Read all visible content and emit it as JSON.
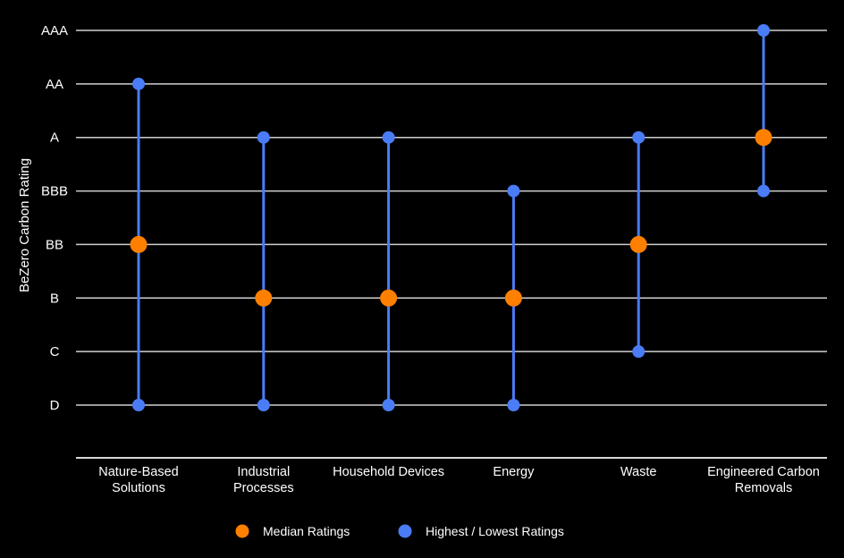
{
  "chart_data": {
    "type": "range-dot",
    "title": "",
    "ylabel": "BeZero Carbon Rating",
    "xlabel": "",
    "y_levels": [
      "D",
      "C",
      "B",
      "BB",
      "BBB",
      "A",
      "AA",
      "AAA"
    ],
    "categories": [
      [
        "Nature-Based",
        "Solutions"
      ],
      [
        "Industrial",
        "Processes"
      ],
      [
        "Household Devices"
      ],
      [
        "Energy"
      ],
      [
        "Waste"
      ],
      [
        "Engineered Carbon",
        "Removals"
      ]
    ],
    "series": [
      {
        "name": "Highest / Lowest Ratings",
        "color": "#4a7cf6",
        "high": [
          "AA",
          "A",
          "A",
          "BBB",
          "A",
          "AAA"
        ],
        "low": [
          "D",
          "D",
          "D",
          "D",
          "C",
          "BBB"
        ]
      },
      {
        "name": "Median Ratings",
        "color": "#ff8000",
        "values": [
          "BB",
          "B",
          "B",
          "B",
          "BB",
          "A"
        ]
      }
    ],
    "legend": [
      {
        "label": "Median Ratings",
        "color": "#ff8000"
      },
      {
        "label": "Highest / Lowest Ratings",
        "color": "#4a7cf6"
      }
    ],
    "legend_position": "bottom-center",
    "grid": true
  }
}
